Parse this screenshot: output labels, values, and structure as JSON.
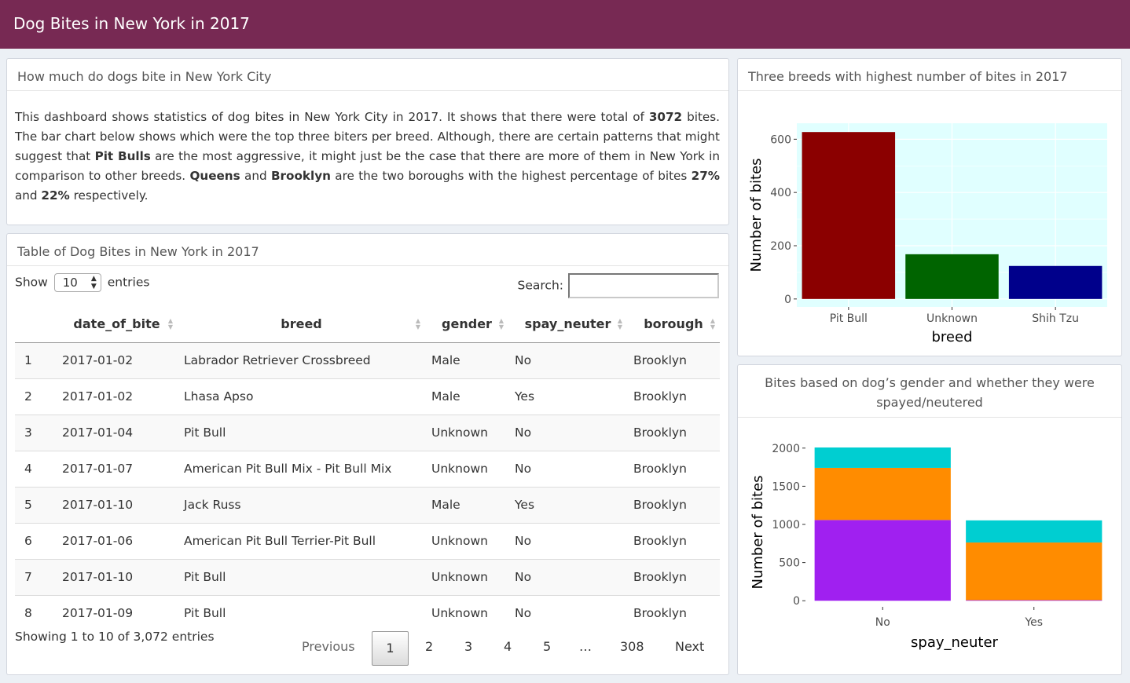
{
  "header": {
    "title": "Dog Bites in New York in 2017"
  },
  "intro_box": {
    "title": "How much do dogs bite in New York City",
    "p1": "This dashboard shows statistics of dog bites in New York City in 2017. It shows that there were total of ",
    "total": "3072",
    "p2": " bites. The bar chart below shows which were the top three biters per breed. Although, there are certain patterns that might suggest that ",
    "pitbulls": "Pit Bulls",
    "p3": " are the most aggressive, it might just be the case that there are more of them in New York in comparison to other breeds. ",
    "queens": "Queens",
    "p4": " and ",
    "brooklyn": "Brooklyn",
    "p5": " are the two boroughs with the highest percentage of bites ",
    "pct1": "27%",
    "p6": " and ",
    "pct2": "22%",
    "p7": " respectively."
  },
  "table_box": {
    "title": "Table of Dog Bites in New York in 2017",
    "show_label": "Show",
    "entries_value": "10",
    "entries_label": "entries",
    "search_label": "Search:",
    "columns": [
      "",
      "date_of_bite",
      "breed",
      "gender",
      "spay_neuter",
      "borough"
    ],
    "rows": [
      [
        "1",
        "2017-01-02",
        "Labrador Retriever Crossbreed",
        "Male",
        "No",
        "Brooklyn"
      ],
      [
        "2",
        "2017-01-02",
        "Lhasa Apso",
        "Male",
        "Yes",
        "Brooklyn"
      ],
      [
        "3",
        "2017-01-04",
        "Pit Bull",
        "Unknown",
        "No",
        "Brooklyn"
      ],
      [
        "4",
        "2017-01-07",
        "American Pit Bull Mix - Pit Bull Mix",
        "Unknown",
        "No",
        "Brooklyn"
      ],
      [
        "5",
        "2017-01-10",
        "Jack Russ",
        "Male",
        "Yes",
        "Brooklyn"
      ],
      [
        "6",
        "2017-01-06",
        "American Pit Bull Terrier-Pit Bull",
        "Unknown",
        "No",
        "Brooklyn"
      ],
      [
        "7",
        "2017-01-10",
        "Pit Bull",
        "Unknown",
        "No",
        "Brooklyn"
      ],
      [
        "8",
        "2017-01-09",
        "Pit Bull",
        "Unknown",
        "No",
        "Brooklyn"
      ]
    ],
    "info": "Showing 1 to 10 of 3,072 entries",
    "pagination": {
      "previous": "Previous",
      "pages": [
        "1",
        "2",
        "3",
        "4",
        "5",
        "…",
        "308"
      ],
      "next": "Next"
    }
  },
  "chart_data": [
    {
      "type": "bar",
      "title": "Three breeds with highest number of bites in 2017",
      "categories": [
        "Pit Bull",
        "Unknown",
        "Shih Tzu"
      ],
      "values": [
        627,
        168,
        124
      ],
      "colors": [
        "#8b0000",
        "#006400",
        "#00008b"
      ],
      "panel_background": "#e0ffff",
      "xlabel": "breed",
      "ylabel": "Number of bites",
      "ylim": [
        -30,
        660
      ],
      "yticks": [
        0,
        200,
        400,
        600
      ],
      "grid": true
    },
    {
      "type": "bar",
      "stacked": true,
      "title": "Bites based on dog’s gender and whether they were spayed/neutered",
      "categories": [
        "No",
        "Yes"
      ],
      "series": [
        {
          "values": [
            1058,
            8
          ],
          "color": "#a020f0"
        },
        {
          "values": [
            683,
            755
          ],
          "color": "#ff8c00"
        },
        {
          "values": [
            267,
            290
          ],
          "color": "#00ced1"
        }
      ],
      "xlabel": "spay_neuter",
      "ylabel": "Number of bites",
      "ylim": [
        -80,
        2080
      ],
      "yticks": [
        0,
        500,
        1000,
        1500,
        2000
      ],
      "grid": false
    }
  ]
}
